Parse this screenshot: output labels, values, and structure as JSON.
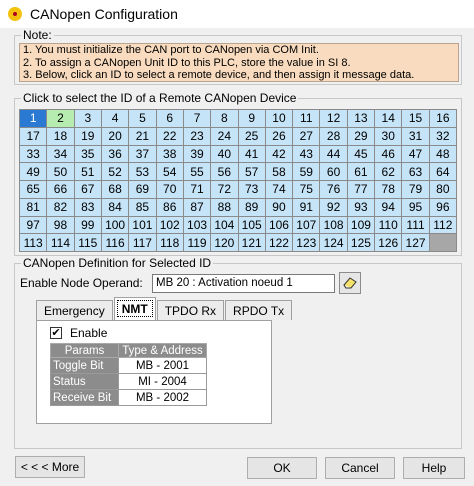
{
  "window": {
    "title": "CANopen Configuration"
  },
  "note": {
    "legend": "Note:",
    "lines": [
      "1. You must initialize the CAN port to CANopen via COM Init.",
      "2. To assign a CANopen Unit ID to this PLC, store the value in SI 8.",
      "3. Below, click an ID to select a remote device, and then assign it message data."
    ]
  },
  "id_select": {
    "legend": "Click to select the ID of a Remote CANopen Device",
    "selected_id": 1,
    "highlighted_id": 2,
    "max_id": 127
  },
  "definition": {
    "legend": "CANopen Definition for Selected ID",
    "operand_label": "Enable Node Operand:",
    "operand_value": "MB 20 : Activation noeud 1",
    "tabs": [
      "Emergency",
      "NMT",
      "TPDO Rx",
      "RPDO Tx"
    ],
    "active_tab": "NMT",
    "enable_label": "Enable",
    "enable_checked": true,
    "table": {
      "headers": [
        "Params",
        "Type & Address"
      ],
      "rows": [
        {
          "param": "Toggle Bit",
          "value": "MB - 2001"
        },
        {
          "param": "Status",
          "value": "MI - 2004"
        },
        {
          "param": "Receive Bit",
          "value": "MB - 2002"
        }
      ]
    }
  },
  "buttons": {
    "more": "< < <   More",
    "ok": "OK",
    "cancel": "Cancel",
    "help": "Help"
  },
  "icons": {
    "app": "canopen-app-icon",
    "edit": "eraser-edit-icon"
  }
}
